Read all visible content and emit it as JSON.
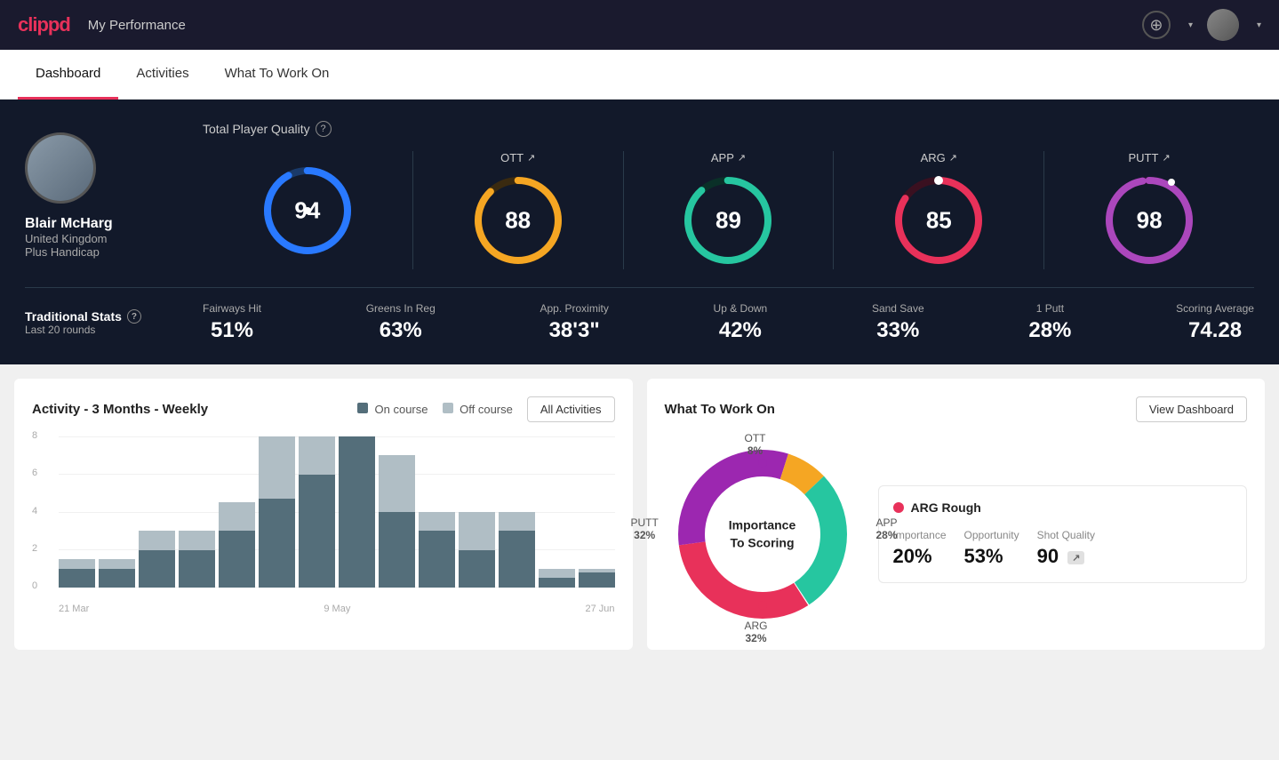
{
  "app": {
    "logo": "clippd",
    "header_title": "My Performance"
  },
  "nav": {
    "tabs": [
      {
        "label": "Dashboard",
        "active": true
      },
      {
        "label": "Activities",
        "active": false
      },
      {
        "label": "What To Work On",
        "active": false
      }
    ]
  },
  "player": {
    "name": "Blair McHarg",
    "country": "United Kingdom",
    "handicap": "Plus Handicap"
  },
  "quality": {
    "section_label": "Total Player Quality",
    "main": {
      "value": "94",
      "color": "#2979ff",
      "track": "#1a3a6a"
    },
    "gauges": [
      {
        "label": "OTT",
        "value": "88",
        "color": "#f5a623",
        "track": "#3a2a10"
      },
      {
        "label": "APP",
        "value": "89",
        "color": "#26c6a0",
        "track": "#0a3028"
      },
      {
        "label": "ARG",
        "value": "85",
        "color": "#e8315a",
        "track": "#3a1020"
      },
      {
        "label": "PUTT",
        "value": "98",
        "color": "#ab47bc",
        "track": "#2a1030"
      }
    ]
  },
  "traditional_stats": {
    "label": "Traditional Stats",
    "sublabel": "Last 20 rounds",
    "items": [
      {
        "name": "Fairways Hit",
        "value": "51%"
      },
      {
        "name": "Greens In Reg",
        "value": "63%"
      },
      {
        "name": "App. Proximity",
        "value": "38'3\""
      },
      {
        "name": "Up & Down",
        "value": "42%"
      },
      {
        "name": "Sand Save",
        "value": "33%"
      },
      {
        "name": "1 Putt",
        "value": "28%"
      },
      {
        "name": "Scoring Average",
        "value": "74.28"
      }
    ]
  },
  "activity_chart": {
    "title": "Activity - 3 Months - Weekly",
    "legend_on": "On course",
    "legend_off": "Off course",
    "all_activities_btn": "All Activities",
    "y_labels": [
      "8",
      "6",
      "4",
      "2",
      "0"
    ],
    "x_labels": [
      "21 Mar",
      "9 May",
      "27 Jun"
    ],
    "bars": [
      {
        "on": 1,
        "off": 0.5
      },
      {
        "on": 1,
        "off": 0.5
      },
      {
        "on": 2,
        "off": 1
      },
      {
        "on": 2,
        "off": 1
      },
      {
        "on": 3,
        "off": 1.5
      },
      {
        "on": 5,
        "off": 3.5
      },
      {
        "on": 6,
        "off": 2
      },
      {
        "on": 8,
        "off": 0
      },
      {
        "on": 4,
        "off": 3
      },
      {
        "on": 3,
        "off": 1
      },
      {
        "on": 2,
        "off": 2
      },
      {
        "on": 3,
        "off": 1
      },
      {
        "on": 0.5,
        "off": 0.5
      },
      {
        "on": 0.8,
        "off": 0.2
      }
    ]
  },
  "what_to_work_on": {
    "title": "What To Work On",
    "view_dashboard_btn": "View Dashboard",
    "donut_center_line1": "Importance",
    "donut_center_line2": "To Scoring",
    "segments": [
      {
        "label": "OTT",
        "pct": "8%",
        "color": "#f5a623"
      },
      {
        "label": "APP",
        "pct": "28%",
        "color": "#26c6a0"
      },
      {
        "label": "ARG",
        "pct": "32%",
        "color": "#e8315a"
      },
      {
        "label": "PUTT",
        "pct": "32%",
        "color": "#9c27b0"
      }
    ],
    "info_card": {
      "title": "ARG Rough",
      "dot_color": "#e8315a",
      "metrics": [
        {
          "name": "Importance",
          "value": "20%"
        },
        {
          "name": "Opportunity",
          "value": "53%"
        },
        {
          "name": "Shot Quality",
          "value": "90",
          "badge": "↗"
        }
      ]
    }
  }
}
